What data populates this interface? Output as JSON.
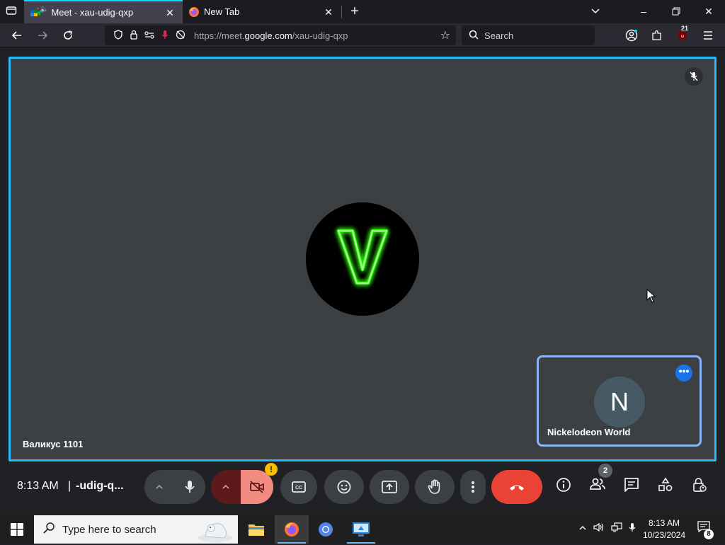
{
  "browser": {
    "tabs": [
      {
        "title": "Meet - xau-udig-qxp",
        "active": true,
        "favicon": "google-meet-icon",
        "audio": true
      },
      {
        "title": "New Tab",
        "active": false,
        "favicon": "firefox-icon"
      }
    ],
    "url_prefix": "https://meet.",
    "url_domain": "google.com",
    "url_path": "/xau-udig-qxp",
    "search_placeholder": "Search",
    "extension_badge": "21",
    "accent_color": "#00ddff"
  },
  "meet": {
    "main_participant": {
      "name": "Валикус 1101",
      "avatar_letter": "V",
      "muted": true,
      "avatar_color": "#39ff14"
    },
    "self_participant": {
      "name": "Nickelodeon World",
      "avatar_letter": "N"
    },
    "clock": "8:13 AM",
    "divider": "|",
    "meeting_code": "‑udig‑q...",
    "people_count": "2",
    "camera_warning": "!",
    "colors": {
      "active_border": "#29b6f6",
      "end_call": "#ea4335",
      "tile_bg": "#3c4043"
    }
  },
  "taskbar": {
    "search_placeholder": "Type here to search",
    "time": "8:13 AM",
    "date": "10/23/2024",
    "notification_count": "8",
    "apps": [
      "file-explorer-icon",
      "firefox-icon",
      "chromium-icon",
      "remote-desktop-icon"
    ]
  }
}
